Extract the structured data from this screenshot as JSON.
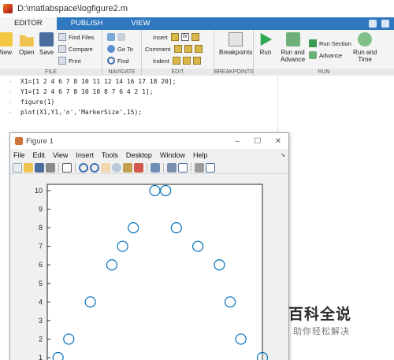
{
  "window": {
    "title": "D:\\matlabspace\\logfigure2.m"
  },
  "tabs": [
    {
      "label": "EDITOR"
    },
    {
      "label": "PUBLISH"
    },
    {
      "label": "VIEW"
    }
  ],
  "ribbon": {
    "file": {
      "label": "FILE",
      "new": "New",
      "open": "Open",
      "save": "Save",
      "find_files": "Find Files",
      "compare": "Compare",
      "print": "Print"
    },
    "navigate": {
      "label": "NAVIGATE",
      "go_to": "Go To",
      "find": "Find"
    },
    "edit": {
      "label": "EDIT",
      "insert": "Insert",
      "comment": "Comment",
      "indent": "Indent",
      "fx": "fx"
    },
    "breakpoints": {
      "label": "BREAKPOINTS",
      "button": "Breakpoints"
    },
    "run": {
      "label": "RUN",
      "run": "Run",
      "run_and_advance_1": "Run and",
      "run_and_advance_2": "Advance",
      "run_section": "Run Section",
      "advance": "Advance",
      "run_and_time_1": "Run and",
      "run_and_time_2": "Time"
    }
  },
  "editor": {
    "lines": [
      "X1=[1 2 4 6 7 8 10 11 12 14 16 17 18 20];",
      "Y1=[1 2 4 6 7 8 10 10 8 7 6 4 2 1];",
      "figure(1)",
      "plot(X1,Y1,'o','MarkerSize',15);"
    ],
    "gutter_mark": "-"
  },
  "figure": {
    "title": "Figure 1",
    "menu": [
      "File",
      "Edit",
      "View",
      "Insert",
      "Tools",
      "Desktop",
      "Window",
      "Help"
    ],
    "window_buttons": [
      "–",
      "☐",
      "✕"
    ]
  },
  "chart_data": {
    "type": "scatter",
    "marker": "o",
    "marker_color": "#0072bd",
    "x": [
      1,
      2,
      4,
      6,
      7,
      8,
      10,
      11,
      12,
      14,
      16,
      17,
      18,
      20
    ],
    "y": [
      1,
      2,
      4,
      6,
      7,
      8,
      10,
      10,
      8,
      7,
      6,
      4,
      2,
      1
    ],
    "y_ticks": [
      "10",
      "9",
      "8",
      "7",
      "6",
      "5",
      "4",
      "3",
      "2",
      "1"
    ],
    "xlim": [
      0,
      20
    ],
    "ylim": [
      1,
      10
    ],
    "grid": false
  },
  "watermark": {
    "title": "百科全说",
    "subtitle": "助你轻松解决"
  }
}
